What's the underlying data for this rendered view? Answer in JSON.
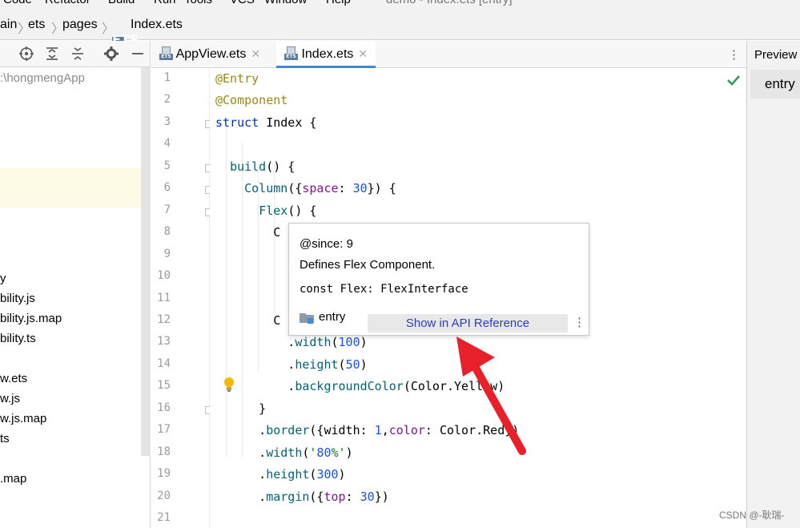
{
  "menubar": {
    "items": [
      "Code",
      "Refactor",
      "Build",
      "Run",
      "Tools",
      "VCS",
      "Window",
      "Help"
    ],
    "title": "demo - Index.ets [entry]"
  },
  "breadcrumb": [
    "ain",
    "ets",
    "pages",
    "Index.ets"
  ],
  "tabs": [
    {
      "label": "AppView.ets",
      "active": false
    },
    {
      "label": "Index.ets",
      "active": true
    }
  ],
  "project": {
    "root": ":\\hongmengApp",
    "items": [
      "y",
      "bility.js",
      "bility.js.map",
      "bility.ts",
      "w.ets",
      "w.js",
      "w.js.map",
      "ts",
      ".map"
    ]
  },
  "editor": {
    "line_numbers": [
      "1",
      "2",
      "3",
      "4",
      "5",
      "6",
      "7",
      "8",
      "9",
      "10",
      "11",
      "12",
      "13",
      "14",
      "15",
      "16",
      "17",
      "18",
      "19",
      "20",
      "21"
    ],
    "lines": [
      "@Entry",
      "@Component",
      "struct Index {",
      "",
      "  build() {",
      "    Column({space: 30}) {",
      "      Flex() {",
      "        C",
      "",
      "",
      "",
      "        C",
      "          .width(100)",
      "          .height(50)",
      "          .backgroundColor(Color.Yellow)",
      "      }",
      "      .border({width: 1,color: Color.Red})",
      "      .width('80%')",
      "      .height(300)",
      "      .margin({top: 30})",
      ""
    ]
  },
  "popup": {
    "since": "@since: 9",
    "description": "Defines Flex Component.",
    "signature": "const Flex: FlexInterface",
    "module": "entry",
    "button": "Show in API Reference"
  },
  "right_panel": {
    "title": "Preview",
    "tab": "entry"
  },
  "watermark": "CSDN @-耿瑞-",
  "colors": {
    "accent": "#4a84c9",
    "arrow": "#e8202a",
    "check": "#2e9b4a"
  }
}
